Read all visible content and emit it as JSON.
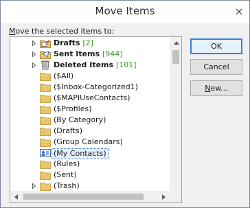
{
  "window": {
    "title": "Move Items"
  },
  "prompt": {
    "prefix_underlined": "M",
    "rest": "ove the selected items to:"
  },
  "tree": {
    "items": [
      {
        "label": "Drafts",
        "count": "[2]",
        "bold": true,
        "expandable": true,
        "icon": "drafts-icon"
      },
      {
        "label": "Sent Items",
        "count": "[944]",
        "bold": true,
        "expandable": true,
        "icon": "sent-items-icon"
      },
      {
        "label": "Deleted Items",
        "count": "[101]",
        "bold": true,
        "expandable": true,
        "icon": "deleted-items-icon"
      },
      {
        "label": "($All)",
        "count": "",
        "bold": false,
        "expandable": false,
        "icon": "folder-icon"
      },
      {
        "label": "($Inbox-Categorized1)",
        "count": "",
        "bold": false,
        "expandable": false,
        "icon": "folder-icon"
      },
      {
        "label": "($MAPIUseContacts)",
        "count": "",
        "bold": false,
        "expandable": false,
        "icon": "folder-icon"
      },
      {
        "label": "($Profiles)",
        "count": "",
        "bold": false,
        "expandable": false,
        "icon": "folder-icon"
      },
      {
        "label": "(By Category)",
        "count": "",
        "bold": false,
        "expandable": false,
        "icon": "folder-icon"
      },
      {
        "label": "(Drafts)",
        "count": "",
        "bold": false,
        "expandable": false,
        "icon": "folder-icon"
      },
      {
        "label": "(Group Calendars)",
        "count": "",
        "bold": false,
        "expandable": false,
        "icon": "folder-icon"
      },
      {
        "label": "(My Contacts)",
        "count": "",
        "bold": false,
        "expandable": false,
        "icon": "contacts-icon",
        "selected": true
      },
      {
        "label": "(Rules)",
        "count": "",
        "bold": false,
        "expandable": false,
        "icon": "folder-icon"
      },
      {
        "label": "(Sent)",
        "count": "",
        "bold": false,
        "expandable": false,
        "icon": "folder-icon"
      },
      {
        "label": "(Trash)",
        "count": "",
        "bold": false,
        "expandable": true,
        "icon": "folder-icon"
      }
    ]
  },
  "buttons": {
    "ok": "OK",
    "cancel": "Cancel",
    "new_underlined": "N",
    "new_rest": "ew..."
  },
  "colors": {
    "count_green": "#3a9a2a",
    "selection_border": "#2a6ad4",
    "default_button_border": "#3c7fd6",
    "folder_yellow": "#e8c56a"
  }
}
